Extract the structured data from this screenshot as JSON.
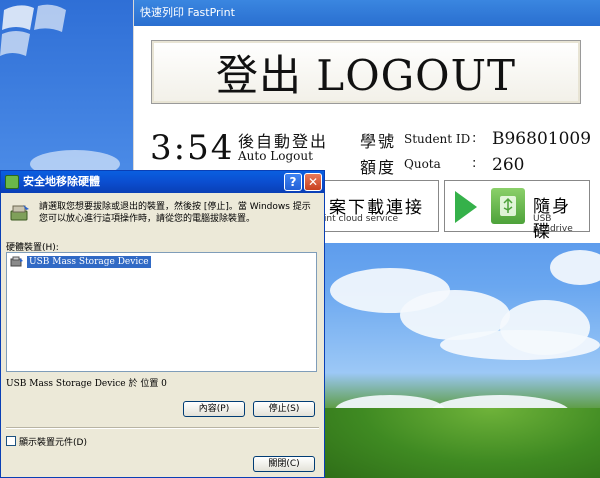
{
  "fastprint": {
    "title": "快速列印 FastPrint",
    "logout_label": "登出 LOGOUT",
    "countdown": "3:54",
    "auto_logout_zh": "後自動登出",
    "auto_logout_en": "Auto Logout",
    "student_id_zh": "學號",
    "student_id_en": "Student ID",
    "student_id_value": "B96801009",
    "quota_zh": "額度",
    "quota_en": "Quota",
    "quota_value": "260",
    "colon": ":",
    "cloud_zh": "案下載連接",
    "cloud_en": "print cloud service",
    "usb_zh": "隨身碟",
    "usb_en": "USB pendrive",
    "accent_color": "#35b14a"
  },
  "dialog": {
    "title": "安全地移除硬體",
    "help_glyph": "?",
    "close_glyph": "✕",
    "instructions": "請選取您想要拔除或退出的裝置，然後按 [停止]。當 Windows 提示您可以放心進行這項操作時，請從您的電腦拔除裝置。",
    "devices_label": "硬體裝置(H):",
    "device_item": "USB Mass Storage Device",
    "device_location": "USB Mass Storage Device 於 位置 0",
    "properties_button": "內容(P)",
    "stop_button": "停止(S)",
    "show_components": "顯示裝置元件(D)",
    "close_button": "關閉(C)"
  }
}
